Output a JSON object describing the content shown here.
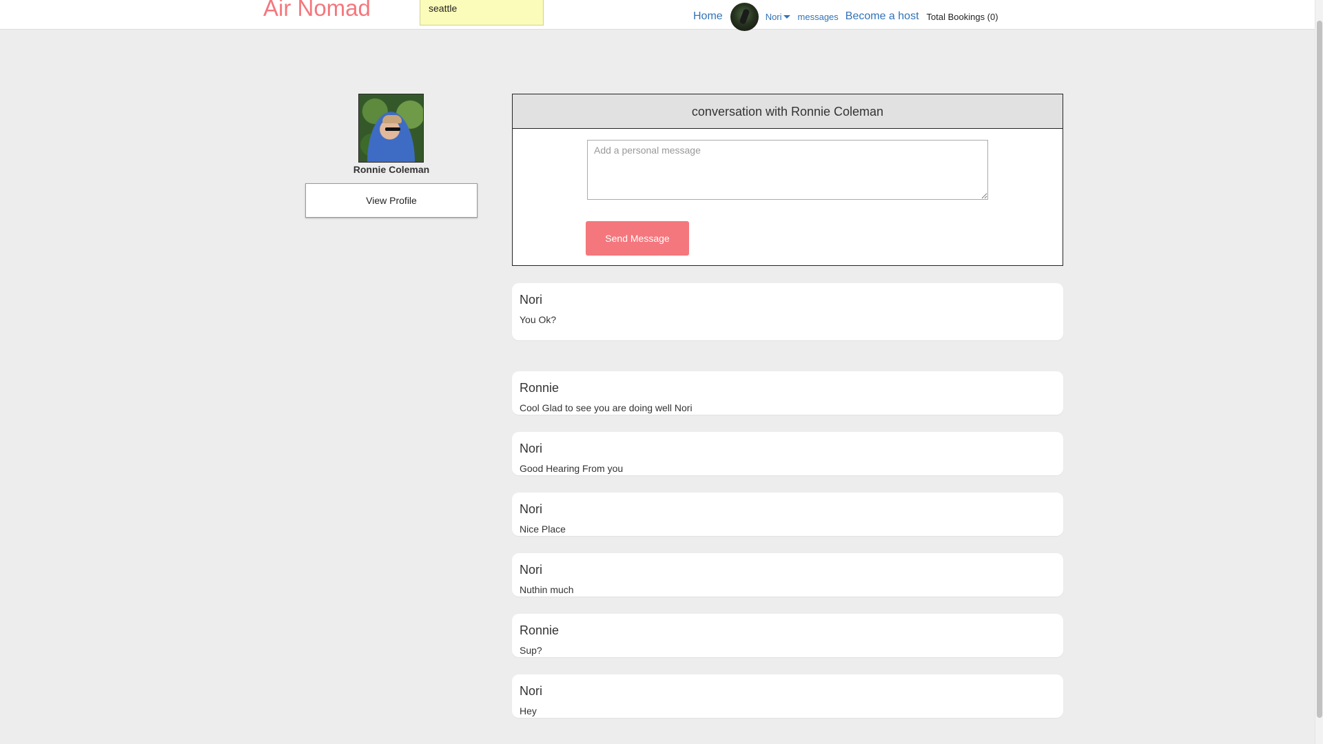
{
  "nav": {
    "brand": "Air Nomad",
    "search_value": "seattle",
    "home": "Home",
    "user": "Nori",
    "messages": "messages",
    "become_host": "Become a host",
    "total_bookings": "Total Bookings (0)"
  },
  "profile": {
    "name": "Ronnie Coleman",
    "view_profile": "View Profile"
  },
  "conversation": {
    "title": "conversation with Ronnie Coleman",
    "placeholder": "Add a personal message",
    "send_label": "Send Message"
  },
  "messages": [
    {
      "sender": "Nori",
      "text": "You Ok?"
    },
    {
      "sender": "Ronnie",
      "text": "Cool Glad to see you are doing well Nori"
    },
    {
      "sender": "Nori",
      "text": "Good Hearing From you"
    },
    {
      "sender": "Nori",
      "text": "Nice Place"
    },
    {
      "sender": "Nori",
      "text": "Nuthin much"
    },
    {
      "sender": "Ronnie",
      "text": "Sup?"
    },
    {
      "sender": "Nori",
      "text": "Hey"
    }
  ],
  "colors": {
    "brand": "#f4777d",
    "link": "#3173b6",
    "background": "#ededed",
    "search_bg": "#fbfbba"
  }
}
